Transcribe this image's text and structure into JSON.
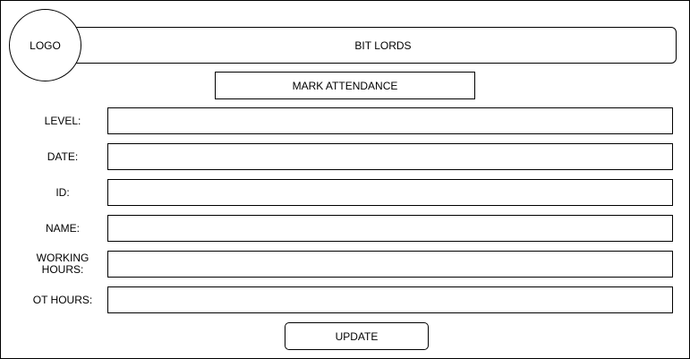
{
  "header": {
    "logo_text": "LOGO",
    "brand_title": "BIT LORDS"
  },
  "page": {
    "title": "MARK ATTENDANCE"
  },
  "form": {
    "fields": [
      {
        "label": "LEVEL:",
        "value": ""
      },
      {
        "label": "DATE:",
        "value": ""
      },
      {
        "label": "ID:",
        "value": ""
      },
      {
        "label": "NAME:",
        "value": ""
      },
      {
        "label": "WORKING HOURS:",
        "value": ""
      },
      {
        "label": "OT HOURS:",
        "value": ""
      }
    ],
    "submit_label": "UPDATE"
  }
}
